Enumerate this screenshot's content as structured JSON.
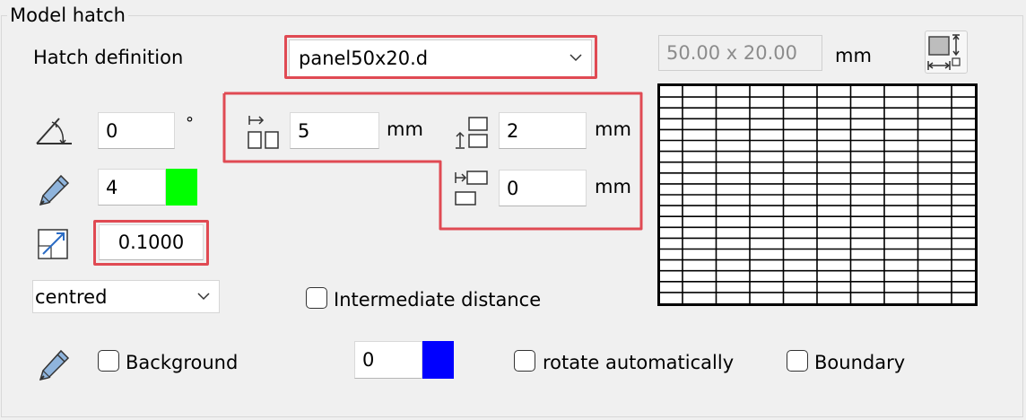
{
  "group": {
    "title": "Model hatch"
  },
  "hatch_definition": {
    "label": "Hatch definition",
    "selected": "panel50x20.d",
    "size_display": "50.00 x 20.00",
    "size_unit": "mm"
  },
  "angle": {
    "value": "0",
    "unit": "°"
  },
  "pen": {
    "value": "4",
    "color": "#00ff00"
  },
  "scale": {
    "value": "0.1000"
  },
  "offsets": {
    "horizontal": {
      "value": "5",
      "unit": "mm"
    },
    "vertical": {
      "value": "2",
      "unit": "mm"
    },
    "row_offset": {
      "value": "0",
      "unit": "mm"
    }
  },
  "alignment": {
    "selected": "centred"
  },
  "intermediate_distance": {
    "label": "Intermediate distance",
    "checked": false
  },
  "background": {
    "label": "Background",
    "checked": false,
    "pen_value": "0",
    "color": "#0000ff"
  },
  "rotate_automatically": {
    "label": "rotate automatically",
    "checked": false
  },
  "boundary": {
    "label": "Boundary",
    "checked": false
  },
  "highlight_color": "#e04a53"
}
